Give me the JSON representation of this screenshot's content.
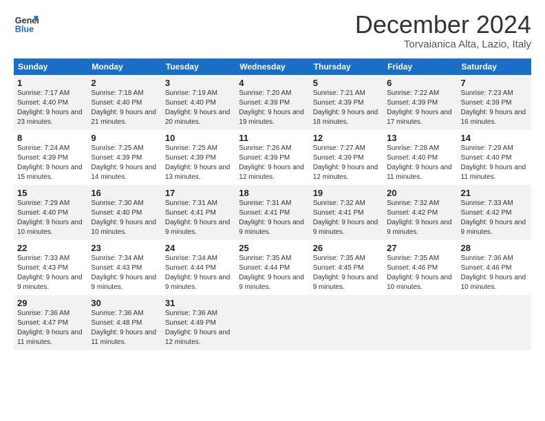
{
  "header": {
    "logo_line1": "General",
    "logo_line2": "Blue",
    "month": "December 2024",
    "location": "Torvaianica Alta, Lazio, Italy"
  },
  "weekdays": [
    "Sunday",
    "Monday",
    "Tuesday",
    "Wednesday",
    "Thursday",
    "Friday",
    "Saturday"
  ],
  "weeks": [
    [
      {
        "day": "1",
        "sunrise": "Sunrise: 7:17 AM",
        "sunset": "Sunset: 4:40 PM",
        "daylight": "Daylight: 9 hours and 23 minutes."
      },
      {
        "day": "2",
        "sunrise": "Sunrise: 7:18 AM",
        "sunset": "Sunset: 4:40 PM",
        "daylight": "Daylight: 9 hours and 21 minutes."
      },
      {
        "day": "3",
        "sunrise": "Sunrise: 7:19 AM",
        "sunset": "Sunset: 4:40 PM",
        "daylight": "Daylight: 9 hours and 20 minutes."
      },
      {
        "day": "4",
        "sunrise": "Sunrise: 7:20 AM",
        "sunset": "Sunset: 4:39 PM",
        "daylight": "Daylight: 9 hours and 19 minutes."
      },
      {
        "day": "5",
        "sunrise": "Sunrise: 7:21 AM",
        "sunset": "Sunset: 4:39 PM",
        "daylight": "Daylight: 9 hours and 18 minutes."
      },
      {
        "day": "6",
        "sunrise": "Sunrise: 7:22 AM",
        "sunset": "Sunset: 4:39 PM",
        "daylight": "Daylight: 9 hours and 17 minutes."
      },
      {
        "day": "7",
        "sunrise": "Sunrise: 7:23 AM",
        "sunset": "Sunset: 4:39 PM",
        "daylight": "Daylight: 9 hours and 16 minutes."
      }
    ],
    [
      {
        "day": "8",
        "sunrise": "Sunrise: 7:24 AM",
        "sunset": "Sunset: 4:39 PM",
        "daylight": "Daylight: 9 hours and 15 minutes."
      },
      {
        "day": "9",
        "sunrise": "Sunrise: 7:25 AM",
        "sunset": "Sunset: 4:39 PM",
        "daylight": "Daylight: 9 hours and 14 minutes."
      },
      {
        "day": "10",
        "sunrise": "Sunrise: 7:25 AM",
        "sunset": "Sunset: 4:39 PM",
        "daylight": "Daylight: 9 hours and 13 minutes."
      },
      {
        "day": "11",
        "sunrise": "Sunrise: 7:26 AM",
        "sunset": "Sunset: 4:39 PM",
        "daylight": "Daylight: 9 hours and 12 minutes."
      },
      {
        "day": "12",
        "sunrise": "Sunrise: 7:27 AM",
        "sunset": "Sunset: 4:39 PM",
        "daylight": "Daylight: 9 hours and 12 minutes."
      },
      {
        "day": "13",
        "sunrise": "Sunrise: 7:28 AM",
        "sunset": "Sunset: 4:40 PM",
        "daylight": "Daylight: 9 hours and 11 minutes."
      },
      {
        "day": "14",
        "sunrise": "Sunrise: 7:29 AM",
        "sunset": "Sunset: 4:40 PM",
        "daylight": "Daylight: 9 hours and 11 minutes."
      }
    ],
    [
      {
        "day": "15",
        "sunrise": "Sunrise: 7:29 AM",
        "sunset": "Sunset: 4:40 PM",
        "daylight": "Daylight: 9 hours and 10 minutes."
      },
      {
        "day": "16",
        "sunrise": "Sunrise: 7:30 AM",
        "sunset": "Sunset: 4:40 PM",
        "daylight": "Daylight: 9 hours and 10 minutes."
      },
      {
        "day": "17",
        "sunrise": "Sunrise: 7:31 AM",
        "sunset": "Sunset: 4:41 PM",
        "daylight": "Daylight: 9 hours and 9 minutes."
      },
      {
        "day": "18",
        "sunrise": "Sunrise: 7:31 AM",
        "sunset": "Sunset: 4:41 PM",
        "daylight": "Daylight: 9 hours and 9 minutes."
      },
      {
        "day": "19",
        "sunrise": "Sunrise: 7:32 AM",
        "sunset": "Sunset: 4:41 PM",
        "daylight": "Daylight: 9 hours and 9 minutes."
      },
      {
        "day": "20",
        "sunrise": "Sunrise: 7:32 AM",
        "sunset": "Sunset: 4:42 PM",
        "daylight": "Daylight: 9 hours and 9 minutes."
      },
      {
        "day": "21",
        "sunrise": "Sunrise: 7:33 AM",
        "sunset": "Sunset: 4:42 PM",
        "daylight": "Daylight: 9 hours and 9 minutes."
      }
    ],
    [
      {
        "day": "22",
        "sunrise": "Sunrise: 7:33 AM",
        "sunset": "Sunset: 4:43 PM",
        "daylight": "Daylight: 9 hours and 9 minutes."
      },
      {
        "day": "23",
        "sunrise": "Sunrise: 7:34 AM",
        "sunset": "Sunset: 4:43 PM",
        "daylight": "Daylight: 9 hours and 9 minutes."
      },
      {
        "day": "24",
        "sunrise": "Sunrise: 7:34 AM",
        "sunset": "Sunset: 4:44 PM",
        "daylight": "Daylight: 9 hours and 9 minutes."
      },
      {
        "day": "25",
        "sunrise": "Sunrise: 7:35 AM",
        "sunset": "Sunset: 4:44 PM",
        "daylight": "Daylight: 9 hours and 9 minutes."
      },
      {
        "day": "26",
        "sunrise": "Sunrise: 7:35 AM",
        "sunset": "Sunset: 4:45 PM",
        "daylight": "Daylight: 9 hours and 9 minutes."
      },
      {
        "day": "27",
        "sunrise": "Sunrise: 7:35 AM",
        "sunset": "Sunset: 4:46 PM",
        "daylight": "Daylight: 9 hours and 10 minutes."
      },
      {
        "day": "28",
        "sunrise": "Sunrise: 7:36 AM",
        "sunset": "Sunset: 4:46 PM",
        "daylight": "Daylight: 9 hours and 10 minutes."
      }
    ],
    [
      {
        "day": "29",
        "sunrise": "Sunrise: 7:36 AM",
        "sunset": "Sunset: 4:47 PM",
        "daylight": "Daylight: 9 hours and 11 minutes."
      },
      {
        "day": "30",
        "sunrise": "Sunrise: 7:36 AM",
        "sunset": "Sunset: 4:48 PM",
        "daylight": "Daylight: 9 hours and 11 minutes."
      },
      {
        "day": "31",
        "sunrise": "Sunrise: 7:36 AM",
        "sunset": "Sunset: 4:49 PM",
        "daylight": "Daylight: 9 hours and 12 minutes."
      },
      null,
      null,
      null,
      null
    ]
  ]
}
